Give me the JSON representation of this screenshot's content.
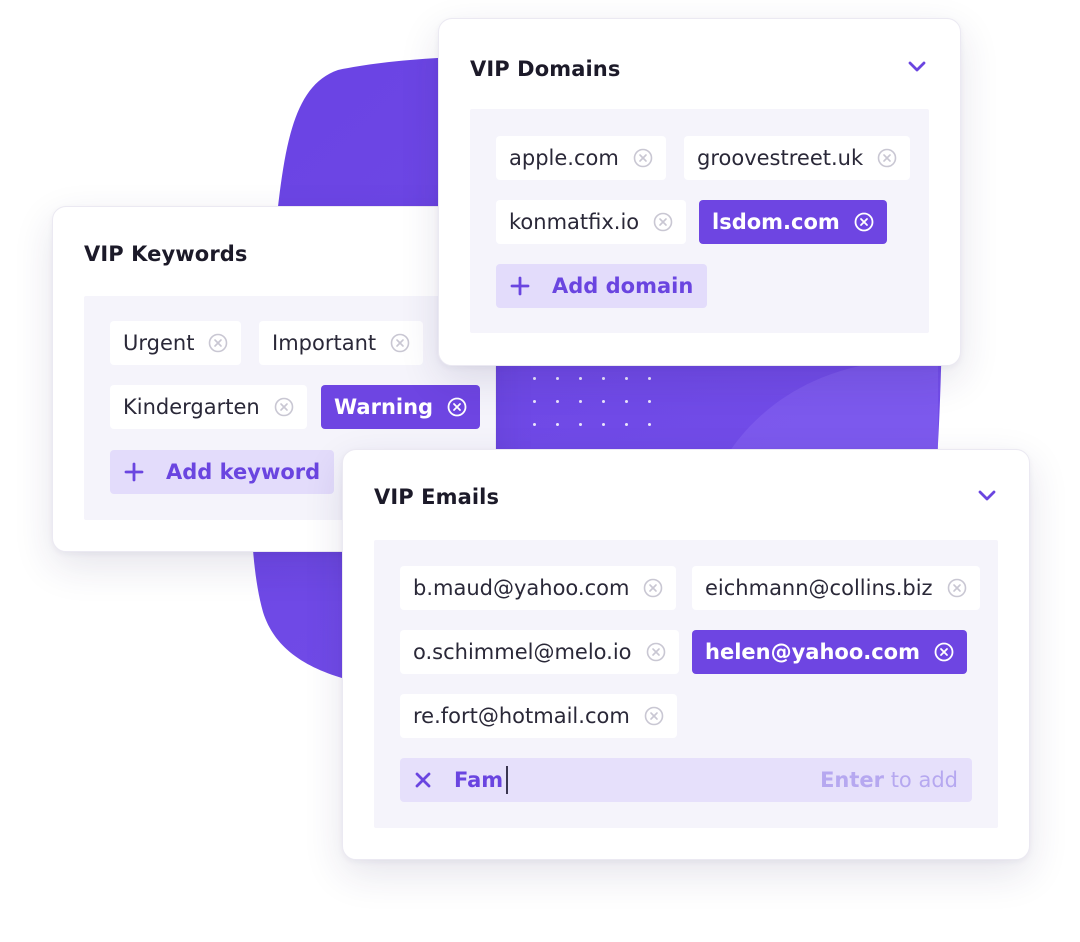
{
  "cards": {
    "domains": {
      "title": "VIP Domains",
      "chips": [
        {
          "label": "apple.com",
          "selected": false
        },
        {
          "label": "groovestreet.uk",
          "selected": false
        },
        {
          "label": "konmatfix.io",
          "selected": false
        },
        {
          "label": "lsdom.com",
          "selected": true
        }
      ],
      "add_label": "Add domain"
    },
    "keywords": {
      "title": "VIP Keywords",
      "chips": [
        {
          "label": "Urgent",
          "selected": false
        },
        {
          "label": "Important",
          "selected": false
        },
        {
          "label": "Kindergarten",
          "selected": false
        },
        {
          "label": "Warning",
          "selected": true
        }
      ],
      "add_label": "Add keyword"
    },
    "emails": {
      "title": "VIP Emails",
      "chips": [
        {
          "label": "b.maud@yahoo.com",
          "selected": false
        },
        {
          "label": "eichmann@collins.biz",
          "selected": false
        },
        {
          "label": "o.schimmel@melo.io",
          "selected": false
        },
        {
          "label": "helen@yahoo.com",
          "selected": true
        },
        {
          "label": "re.fort@hotmail.com",
          "selected": false
        }
      ],
      "input_value": "Fam",
      "hint_key": "Enter",
      "hint_text": "to add"
    }
  },
  "colors": {
    "accent": "#6e45e2",
    "accent_light": "#e3dcfb",
    "panel": "#f5f4fb",
    "blob": "#6b44e4"
  },
  "icons": {
    "chevron": "chevron-down-icon",
    "remove": "remove-circle-icon",
    "add": "plus-icon",
    "clear": "close-icon"
  }
}
